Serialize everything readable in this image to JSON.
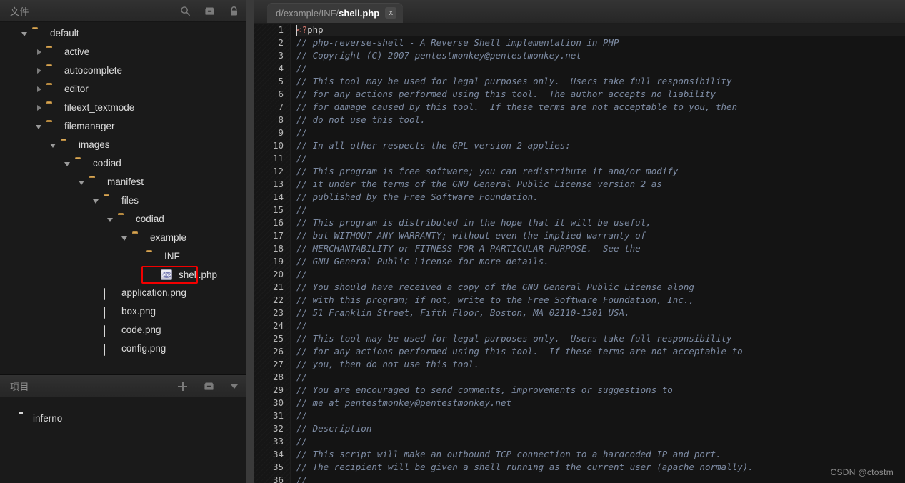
{
  "sidebar": {
    "files_panel": {
      "title": "文件",
      "icons": [
        {
          "name": "search-icon"
        },
        {
          "name": "archive-icon"
        },
        {
          "name": "lock-icon"
        }
      ],
      "tree": [
        {
          "label": "default",
          "depth": 0,
          "arrow": "open",
          "icon": "folder",
          "selected": false
        },
        {
          "label": "active",
          "depth": 1,
          "arrow": "closed",
          "icon": "folder",
          "selected": false
        },
        {
          "label": "autocomplete",
          "depth": 1,
          "arrow": "closed",
          "icon": "folder",
          "selected": false
        },
        {
          "label": "editor",
          "depth": 1,
          "arrow": "closed",
          "icon": "folder",
          "selected": false
        },
        {
          "label": "fileext_textmode",
          "depth": 1,
          "arrow": "closed",
          "icon": "folder",
          "selected": false
        },
        {
          "label": "filemanager",
          "depth": 1,
          "arrow": "open",
          "icon": "folder",
          "selected": false
        },
        {
          "label": "images",
          "depth": 2,
          "arrow": "open",
          "icon": "folder",
          "selected": false
        },
        {
          "label": "codiad",
          "depth": 3,
          "arrow": "open",
          "icon": "folder",
          "selected": false
        },
        {
          "label": "manifest",
          "depth": 4,
          "arrow": "open",
          "icon": "folder",
          "selected": false
        },
        {
          "label": "files",
          "depth": 5,
          "arrow": "open",
          "icon": "folder",
          "selected": false
        },
        {
          "label": "codiad",
          "depth": 6,
          "arrow": "open",
          "icon": "folder",
          "selected": false
        },
        {
          "label": "example",
          "depth": 7,
          "arrow": "open",
          "icon": "folder",
          "selected": false
        },
        {
          "label": "INF",
          "depth": 8,
          "arrow": "none",
          "icon": "folder",
          "selected": false
        },
        {
          "label": "shell.php",
          "depth": 9,
          "arrow": "none",
          "icon": "php",
          "selected": true
        },
        {
          "label": "application.png",
          "depth": 5,
          "arrow": "none",
          "icon": "png",
          "selected": false
        },
        {
          "label": "box.png",
          "depth": 5,
          "arrow": "none",
          "icon": "png",
          "selected": false
        },
        {
          "label": "code.png",
          "depth": 5,
          "arrow": "none",
          "icon": "png",
          "selected": false
        },
        {
          "label": "config.png",
          "depth": 5,
          "arrow": "none",
          "icon": "png",
          "selected": false
        }
      ]
    },
    "projects_panel": {
      "title": "项目",
      "icons": [
        {
          "name": "plus-icon"
        },
        {
          "name": "archive-icon"
        },
        {
          "name": "chevron-down-icon"
        }
      ],
      "projects": [
        {
          "label": "inferno"
        }
      ]
    }
  },
  "editor": {
    "tabs": [
      {
        "path_prefix": "d/example/INF/",
        "filename": "shell.php",
        "close_label": "x",
        "active": true
      }
    ],
    "selection_color": "#f20000",
    "lines": [
      {
        "n": 1,
        "text": "<?php",
        "type": "php-open",
        "active": true
      },
      {
        "n": 2,
        "text": "// php-reverse-shell - A Reverse Shell implementation in PHP",
        "type": "comment"
      },
      {
        "n": 3,
        "text": "// Copyright (C) 2007 pentestmonkey@pentestmonkey.net",
        "type": "comment"
      },
      {
        "n": 4,
        "text": "//",
        "type": "comment"
      },
      {
        "n": 5,
        "text": "// This tool may be used for legal purposes only.  Users take full responsibility",
        "type": "comment"
      },
      {
        "n": 6,
        "text": "// for any actions performed using this tool.  The author accepts no liability",
        "type": "comment"
      },
      {
        "n": 7,
        "text": "// for damage caused by this tool.  If these terms are not acceptable to you, then",
        "type": "comment"
      },
      {
        "n": 8,
        "text": "// do not use this tool.",
        "type": "comment"
      },
      {
        "n": 9,
        "text": "//",
        "type": "comment"
      },
      {
        "n": 10,
        "text": "// In all other respects the GPL version 2 applies:",
        "type": "comment"
      },
      {
        "n": 11,
        "text": "//",
        "type": "comment"
      },
      {
        "n": 12,
        "text": "// This program is free software; you can redistribute it and/or modify",
        "type": "comment"
      },
      {
        "n": 13,
        "text": "// it under the terms of the GNU General Public License version 2 as",
        "type": "comment"
      },
      {
        "n": 14,
        "text": "// published by the Free Software Foundation.",
        "type": "comment"
      },
      {
        "n": 15,
        "text": "//",
        "type": "comment"
      },
      {
        "n": 16,
        "text": "// This program is distributed in the hope that it will be useful,",
        "type": "comment"
      },
      {
        "n": 17,
        "text": "// but WITHOUT ANY WARRANTY; without even the implied warranty of",
        "type": "comment"
      },
      {
        "n": 18,
        "text": "// MERCHANTABILITY or FITNESS FOR A PARTICULAR PURPOSE.  See the",
        "type": "comment"
      },
      {
        "n": 19,
        "text": "// GNU General Public License for more details.",
        "type": "comment"
      },
      {
        "n": 20,
        "text": "//",
        "type": "comment"
      },
      {
        "n": 21,
        "text": "// You should have received a copy of the GNU General Public License along",
        "type": "comment"
      },
      {
        "n": 22,
        "text": "// with this program; if not, write to the Free Software Foundation, Inc.,",
        "type": "comment"
      },
      {
        "n": 23,
        "text": "// 51 Franklin Street, Fifth Floor, Boston, MA 02110-1301 USA.",
        "type": "comment"
      },
      {
        "n": 24,
        "text": "//",
        "type": "comment"
      },
      {
        "n": 25,
        "text": "// This tool may be used for legal purposes only.  Users take full responsibility",
        "type": "comment"
      },
      {
        "n": 26,
        "text": "// for any actions performed using this tool.  If these terms are not acceptable to",
        "type": "comment"
      },
      {
        "n": 27,
        "text": "// you, then do not use this tool.",
        "type": "comment"
      },
      {
        "n": 28,
        "text": "//",
        "type": "comment"
      },
      {
        "n": 29,
        "text": "// You are encouraged to send comments, improvements or suggestions to",
        "type": "comment"
      },
      {
        "n": 30,
        "text": "// me at pentestmonkey@pentestmonkey.net",
        "type": "comment"
      },
      {
        "n": 31,
        "text": "//",
        "type": "comment"
      },
      {
        "n": 32,
        "text": "// Description",
        "type": "comment"
      },
      {
        "n": 33,
        "text": "// -----------",
        "type": "comment"
      },
      {
        "n": 34,
        "text": "// This script will make an outbound TCP connection to a hardcoded IP and port.",
        "type": "comment"
      },
      {
        "n": 35,
        "text": "// The recipient will be given a shell running as the current user (apache normally).",
        "type": "comment"
      },
      {
        "n": 36,
        "text": "//",
        "type": "comment"
      }
    ]
  },
  "watermark": "CSDN @ctostm"
}
